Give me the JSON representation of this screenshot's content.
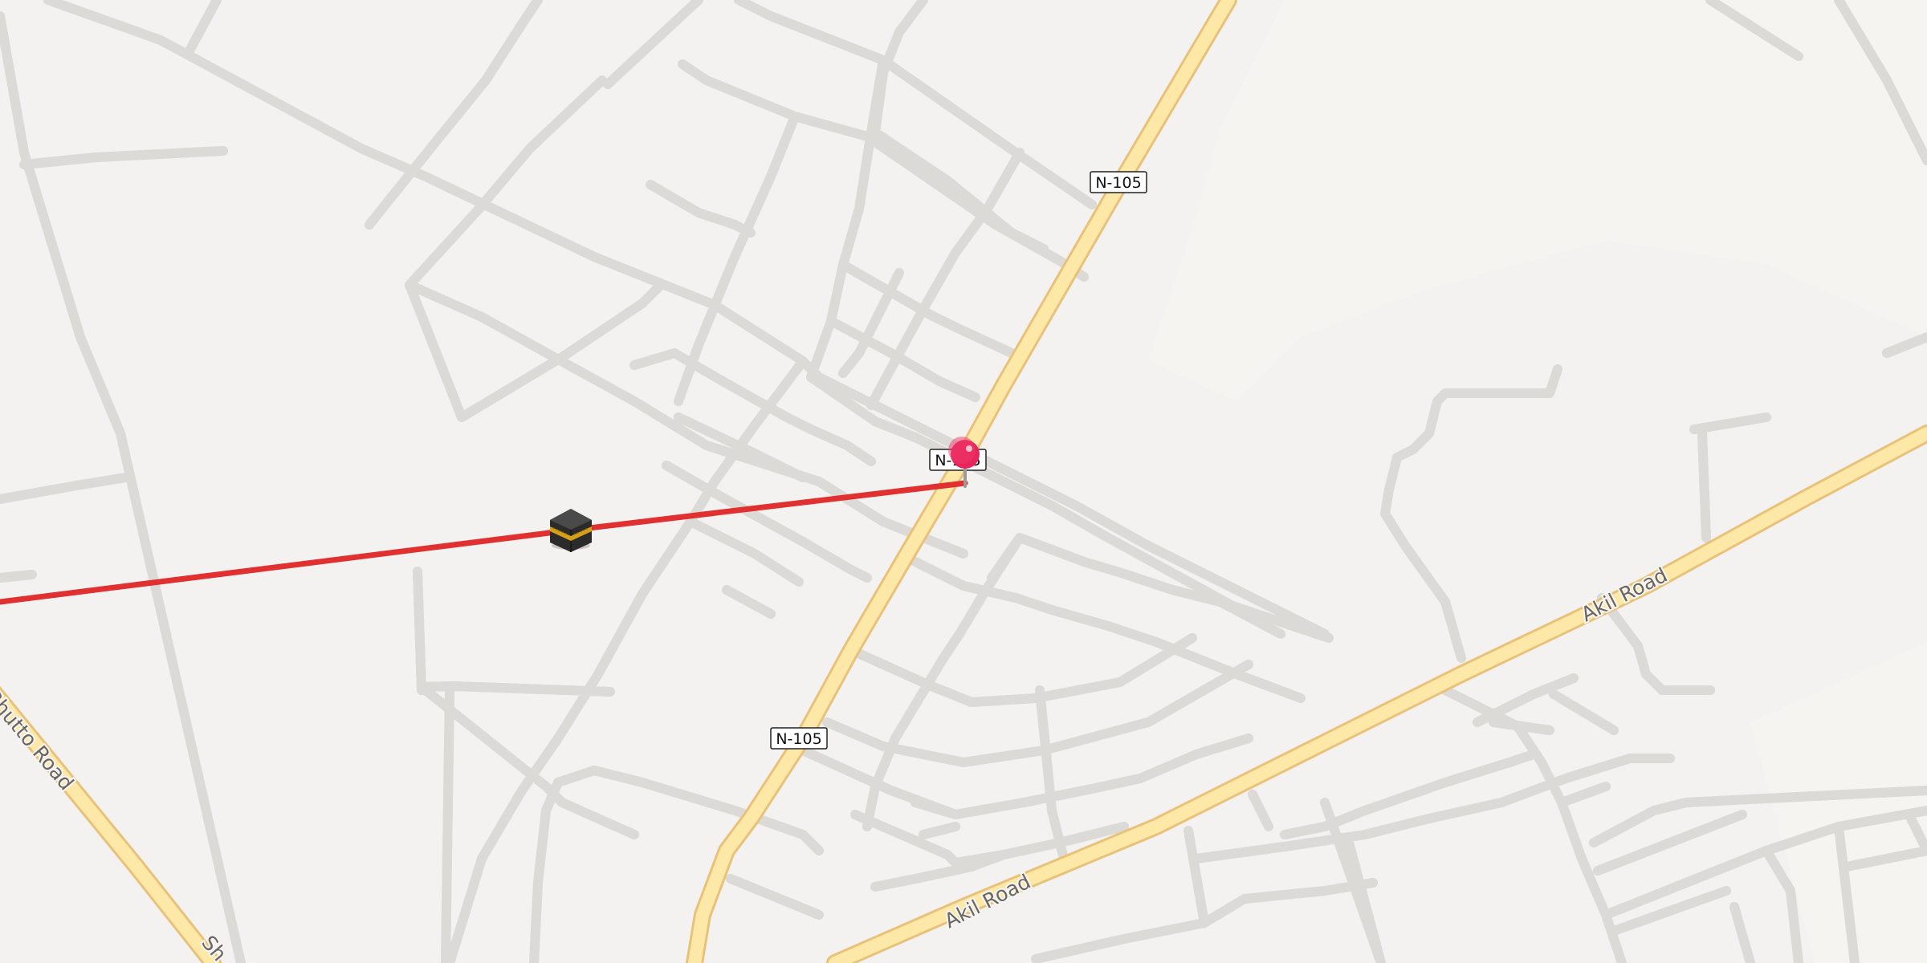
{
  "map": {
    "shields": [
      {
        "id": "n105-top",
        "label": "N-105"
      },
      {
        "id": "n105-center",
        "label": "N-105"
      },
      {
        "id": "n105-lower",
        "label": "N-105"
      }
    ],
    "road_labels": [
      {
        "id": "akil-road-east",
        "label": "Akil Road"
      },
      {
        "id": "akil-road-south",
        "label": "Akil Road"
      },
      {
        "id": "bhutto-road",
        "label": "Benazir Bhutto Road"
      },
      {
        "id": "bhutto-road-end",
        "label": "Sh"
      }
    ],
    "colors": {
      "background": "#f4f2f0",
      "major_road": "#fde8a8",
      "minor_road": "#ffffff",
      "route_line": "#e03030",
      "pin": "#e8245c"
    },
    "markers": [
      {
        "id": "destination-pin",
        "icon": "map-pin-icon"
      },
      {
        "id": "kaaba-marker",
        "icon": "kaaba-icon"
      }
    ]
  }
}
